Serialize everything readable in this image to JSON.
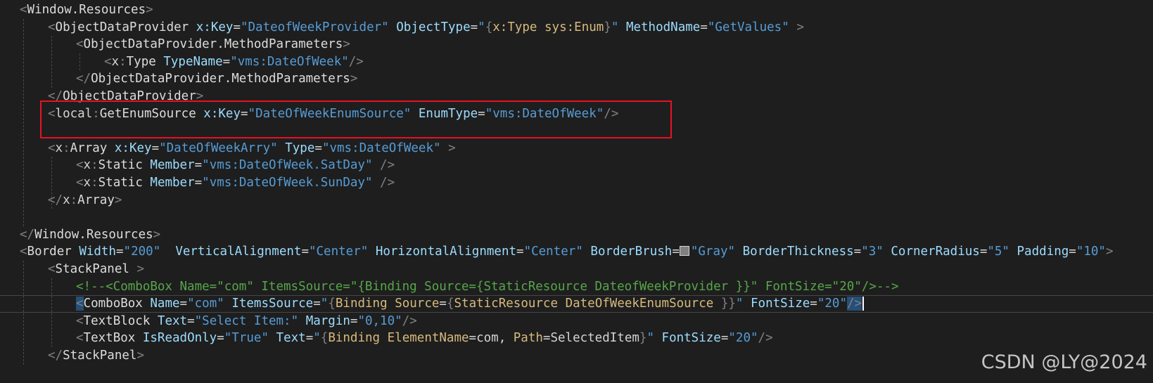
{
  "editor": {
    "colors": {
      "background": "#1e1e1e",
      "delimiter": "#808080",
      "tag": "#dcdcdc",
      "attribute": "#9cdcfe",
      "string": "#569cd6",
      "comment": "#57a64a",
      "markup_extension": "#d7ba7d",
      "selection": "#264f78",
      "annotation_box": "#e81123"
    },
    "lines": [
      {
        "tokens": [
          {
            "t": "<",
            "c": "delim"
          },
          {
            "t": "Window.Resources",
            "c": "tag"
          },
          {
            "t": ">",
            "c": "delim"
          }
        ]
      },
      {
        "tokens": [
          {
            "t": "<",
            "c": "delim"
          },
          {
            "t": "ObjectDataProvider",
            "c": "tag"
          },
          {
            "t": " ",
            "c": "text"
          },
          {
            "t": "x:Key",
            "c": "attr"
          },
          {
            "t": "=",
            "c": "op"
          },
          {
            "t": "\"DateofWeekProvider\"",
            "c": "str"
          },
          {
            "t": " ",
            "c": "text"
          },
          {
            "t": "ObjectType",
            "c": "attr"
          },
          {
            "t": "=",
            "c": "op"
          },
          {
            "t": "\"",
            "c": "str"
          },
          {
            "t": "{",
            "c": "delim"
          },
          {
            "t": "x:Type",
            "c": "ext"
          },
          {
            "t": " ",
            "c": "text"
          },
          {
            "t": "sys:Enum",
            "c": "ext"
          },
          {
            "t": "}",
            "c": "delim"
          },
          {
            "t": "\"",
            "c": "str"
          },
          {
            "t": " ",
            "c": "text"
          },
          {
            "t": "MethodName",
            "c": "attr"
          },
          {
            "t": "=",
            "c": "op"
          },
          {
            "t": "\"GetValues\"",
            "c": "str"
          },
          {
            "t": " ",
            "c": "text"
          },
          {
            "t": ">",
            "c": "delim"
          }
        ]
      },
      {
        "tokens": [
          {
            "t": "<",
            "c": "delim"
          },
          {
            "t": "ObjectDataProvider.MethodParameters",
            "c": "tag"
          },
          {
            "t": ">",
            "c": "delim"
          }
        ]
      },
      {
        "tokens": [
          {
            "t": "<",
            "c": "delim"
          },
          {
            "t": "x",
            "c": "ns"
          },
          {
            "t": ":",
            "c": "delim"
          },
          {
            "t": "Type",
            "c": "tag"
          },
          {
            "t": " ",
            "c": "text"
          },
          {
            "t": "TypeName",
            "c": "attr"
          },
          {
            "t": "=",
            "c": "op"
          },
          {
            "t": "\"vms:DateOfWeek\"",
            "c": "str"
          },
          {
            "t": "/>",
            "c": "delim"
          }
        ]
      },
      {
        "tokens": [
          {
            "t": "</",
            "c": "delim"
          },
          {
            "t": "ObjectDataProvider.MethodParameters",
            "c": "tag"
          },
          {
            "t": ">",
            "c": "delim"
          }
        ]
      },
      {
        "tokens": [
          {
            "t": "</",
            "c": "delim"
          },
          {
            "t": "ObjectDataProvider",
            "c": "tag"
          },
          {
            "t": ">",
            "c": "delim"
          }
        ]
      },
      {
        "tokens": [
          {
            "t": "<",
            "c": "delim"
          },
          {
            "t": "local",
            "c": "ns"
          },
          {
            "t": ":",
            "c": "delim"
          },
          {
            "t": "GetEnumSource",
            "c": "tag"
          },
          {
            "t": " ",
            "c": "text"
          },
          {
            "t": "x:Key",
            "c": "attr"
          },
          {
            "t": "=",
            "c": "op"
          },
          {
            "t": "\"DateOfWeekEnumSource\"",
            "c": "str"
          },
          {
            "t": " ",
            "c": "text"
          },
          {
            "t": "EnumType",
            "c": "attr"
          },
          {
            "t": "=",
            "c": "op"
          },
          {
            "t": "\"vms:DateOfWeek\"",
            "c": "str"
          },
          {
            "t": "/>",
            "c": "delim"
          }
        ]
      },
      {
        "tokens": []
      },
      {
        "tokens": [
          {
            "t": "<",
            "c": "delim"
          },
          {
            "t": "x",
            "c": "ns"
          },
          {
            "t": ":",
            "c": "delim"
          },
          {
            "t": "Array",
            "c": "tag"
          },
          {
            "t": " ",
            "c": "text"
          },
          {
            "t": "x:Key",
            "c": "attr"
          },
          {
            "t": "=",
            "c": "op"
          },
          {
            "t": "\"DateOfWeekArry\"",
            "c": "str"
          },
          {
            "t": " ",
            "c": "text"
          },
          {
            "t": "Type",
            "c": "attr"
          },
          {
            "t": "=",
            "c": "op"
          },
          {
            "t": "\"vms:DateOfWeek\"",
            "c": "str"
          },
          {
            "t": " ",
            "c": "text"
          },
          {
            "t": ">",
            "c": "delim"
          }
        ]
      },
      {
        "tokens": [
          {
            "t": "<",
            "c": "delim"
          },
          {
            "t": "x",
            "c": "ns"
          },
          {
            "t": ":",
            "c": "delim"
          },
          {
            "t": "Static",
            "c": "tag"
          },
          {
            "t": " ",
            "c": "text"
          },
          {
            "t": "Member",
            "c": "attr"
          },
          {
            "t": "=",
            "c": "op"
          },
          {
            "t": "\"vms:DateOfWeek.SatDay\"",
            "c": "str"
          },
          {
            "t": " ",
            "c": "text"
          },
          {
            "t": "/>",
            "c": "delim"
          }
        ]
      },
      {
        "tokens": [
          {
            "t": "<",
            "c": "delim"
          },
          {
            "t": "x",
            "c": "ns"
          },
          {
            "t": ":",
            "c": "delim"
          },
          {
            "t": "Static",
            "c": "tag"
          },
          {
            "t": " ",
            "c": "text"
          },
          {
            "t": "Member",
            "c": "attr"
          },
          {
            "t": "=",
            "c": "op"
          },
          {
            "t": "\"vms:DateOfWeek.SunDay\"",
            "c": "str"
          },
          {
            "t": " ",
            "c": "text"
          },
          {
            "t": "/>",
            "c": "delim"
          }
        ]
      },
      {
        "tokens": [
          {
            "t": "</",
            "c": "delim"
          },
          {
            "t": "x",
            "c": "ns"
          },
          {
            "t": ":",
            "c": "delim"
          },
          {
            "t": "Array",
            "c": "tag"
          },
          {
            "t": ">",
            "c": "delim"
          }
        ]
      },
      {
        "tokens": []
      },
      {
        "tokens": [
          {
            "t": "</",
            "c": "delim"
          },
          {
            "t": "Window.Resources",
            "c": "tag"
          },
          {
            "t": ">",
            "c": "delim"
          }
        ]
      },
      {
        "tokens": [
          {
            "t": "<",
            "c": "delim"
          },
          {
            "t": "Border",
            "c": "tag"
          },
          {
            "t": " ",
            "c": "text"
          },
          {
            "t": "Width",
            "c": "attr"
          },
          {
            "t": "=",
            "c": "op"
          },
          {
            "t": "\"200\"",
            "c": "str"
          },
          {
            "t": "  ",
            "c": "text"
          },
          {
            "t": "VerticalAlignment",
            "c": "attr"
          },
          {
            "t": "=",
            "c": "op"
          },
          {
            "t": "\"Center\"",
            "c": "str"
          },
          {
            "t": " ",
            "c": "text"
          },
          {
            "t": "HorizontalAlignment",
            "c": "attr"
          },
          {
            "t": "=",
            "c": "op"
          },
          {
            "t": "\"Center\"",
            "c": "str"
          },
          {
            "t": " ",
            "c": "text"
          },
          {
            "t": "BorderBrush",
            "c": "attr"
          },
          {
            "t": "=",
            "c": "op"
          },
          {
            "t": "",
            "c": "swatch"
          },
          {
            "t": "\"Gray\"",
            "c": "str"
          },
          {
            "t": " ",
            "c": "text"
          },
          {
            "t": "BorderThickness",
            "c": "attr"
          },
          {
            "t": "=",
            "c": "op"
          },
          {
            "t": "\"3\"",
            "c": "str"
          },
          {
            "t": " ",
            "c": "text"
          },
          {
            "t": "CornerRadius",
            "c": "attr"
          },
          {
            "t": "=",
            "c": "op"
          },
          {
            "t": "\"5\"",
            "c": "str"
          },
          {
            "t": " ",
            "c": "text"
          },
          {
            "t": "Padding",
            "c": "attr"
          },
          {
            "t": "=",
            "c": "op"
          },
          {
            "t": "\"10\"",
            "c": "str"
          },
          {
            "t": ">",
            "c": "delim"
          }
        ]
      },
      {
        "tokens": [
          {
            "t": "<",
            "c": "delim"
          },
          {
            "t": "StackPanel",
            "c": "tag"
          },
          {
            "t": " ",
            "c": "text"
          },
          {
            "t": ">",
            "c": "delim"
          }
        ]
      },
      {
        "tokens": [
          {
            "t": "<!--<ComboBox Name=\"com\" ItemsSource=\"{Binding Source={StaticResource DateofWeekProvider }}\" FontSize=\"20\"/>-->",
            "c": "comment"
          }
        ]
      },
      {
        "tokens": [
          {
            "t": "<",
            "c": "delim sel"
          },
          {
            "t": "ComboBox",
            "c": "tag"
          },
          {
            "t": " ",
            "c": "text"
          },
          {
            "t": "Name",
            "c": "attr"
          },
          {
            "t": "=",
            "c": "op"
          },
          {
            "t": "\"com\"",
            "c": "str"
          },
          {
            "t": " ",
            "c": "text"
          },
          {
            "t": "ItemsSource",
            "c": "attr"
          },
          {
            "t": "=",
            "c": "op"
          },
          {
            "t": "\"",
            "c": "str"
          },
          {
            "t": "{",
            "c": "delim"
          },
          {
            "t": "Binding",
            "c": "ext"
          },
          {
            "t": " ",
            "c": "text"
          },
          {
            "t": "Source",
            "c": "ext"
          },
          {
            "t": "=",
            "c": "op"
          },
          {
            "t": "{",
            "c": "delim"
          },
          {
            "t": "StaticResource",
            "c": "ext"
          },
          {
            "t": " ",
            "c": "text"
          },
          {
            "t": "DateOfWeekEnumSource",
            "c": "ext"
          },
          {
            "t": " ",
            "c": "text"
          },
          {
            "t": "}}",
            "c": "delim"
          },
          {
            "t": "\"",
            "c": "str"
          },
          {
            "t": " ",
            "c": "text"
          },
          {
            "t": "FontSize",
            "c": "attr"
          },
          {
            "t": "=",
            "c": "op"
          },
          {
            "t": "\"20\"",
            "c": "str"
          },
          {
            "t": "/>",
            "c": "delim sel"
          }
        ]
      },
      {
        "tokens": [
          {
            "t": "<",
            "c": "delim"
          },
          {
            "t": "TextBlock",
            "c": "tag"
          },
          {
            "t": " ",
            "c": "text"
          },
          {
            "t": "Text",
            "c": "attr"
          },
          {
            "t": "=",
            "c": "op"
          },
          {
            "t": "\"Select Item:\"",
            "c": "str"
          },
          {
            "t": " ",
            "c": "text"
          },
          {
            "t": "Margin",
            "c": "attr"
          },
          {
            "t": "=",
            "c": "op"
          },
          {
            "t": "\"0,10\"",
            "c": "str"
          },
          {
            "t": "/>",
            "c": "delim"
          }
        ]
      },
      {
        "tokens": [
          {
            "t": "<",
            "c": "delim"
          },
          {
            "t": "TextBox",
            "c": "tag"
          },
          {
            "t": " ",
            "c": "text"
          },
          {
            "t": "IsReadOnly",
            "c": "attr"
          },
          {
            "t": "=",
            "c": "op"
          },
          {
            "t": "\"True\"",
            "c": "str"
          },
          {
            "t": " ",
            "c": "text"
          },
          {
            "t": "Text",
            "c": "attr"
          },
          {
            "t": "=",
            "c": "op"
          },
          {
            "t": "\"",
            "c": "str"
          },
          {
            "t": "{",
            "c": "delim"
          },
          {
            "t": "Binding",
            "c": "ext"
          },
          {
            "t": " ",
            "c": "text"
          },
          {
            "t": "ElementName",
            "c": "ext"
          },
          {
            "t": "=com, ",
            "c": "op"
          },
          {
            "t": "Path",
            "c": "ext"
          },
          {
            "t": "=SelectedItem",
            "c": "op"
          },
          {
            "t": "}",
            "c": "delim"
          },
          {
            "t": "\"",
            "c": "str"
          },
          {
            "t": " ",
            "c": "text"
          },
          {
            "t": "FontSize",
            "c": "attr"
          },
          {
            "t": "=",
            "c": "op"
          },
          {
            "t": "\"20\"",
            "c": "str"
          },
          {
            "t": "/>",
            "c": "delim"
          }
        ]
      },
      {
        "tokens": [
          {
            "t": "</",
            "c": "delim"
          },
          {
            "t": "StackPanel",
            "c": "tag"
          },
          {
            "t": ">",
            "c": "delim"
          }
        ]
      }
    ]
  },
  "watermark": {
    "text": "CSDN @LY@2024"
  }
}
